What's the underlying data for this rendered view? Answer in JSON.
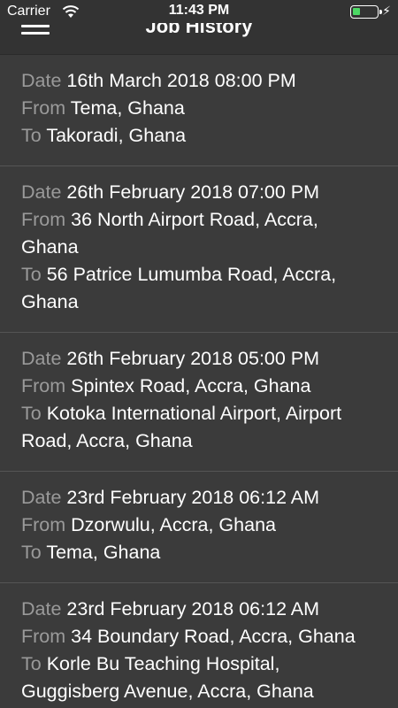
{
  "status_bar": {
    "carrier": "Carrier",
    "time": "11:43 PM",
    "battery_level": 0.3,
    "icons": [
      "wifi-icon",
      "battery-icon",
      "charging-bolt-icon"
    ]
  },
  "nav": {
    "title": "Job History",
    "menu_icon": "hamburger-menu-icon"
  },
  "labels": {
    "date": "Date",
    "from": "From",
    "to": "To"
  },
  "jobs": [
    {
      "date": "16th March 2018 08:00 PM",
      "from": "Tema, Ghana",
      "to": "Takoradi, Ghana"
    },
    {
      "date": "26th February 2018 07:00 PM",
      "from": "36 North Airport Road, Accra, Ghana",
      "to": "56 Patrice Lumumba Road, Accra, Ghana"
    },
    {
      "date": "26th February 2018 05:00 PM",
      "from": "Spintex Road, Accra, Ghana",
      "to": "Kotoka International Airport, Airport Road, Accra, Ghana"
    },
    {
      "date": "23rd February 2018 06:12 AM",
      "from": "Dzorwulu, Accra, Ghana",
      "to": "Tema, Ghana"
    },
    {
      "date": "23rd February 2018 06:12 AM",
      "from": "34 Boundary Road, Accra, Ghana",
      "to": "Korle Bu Teaching Hospital, Guggisberg Avenue, Accra, Ghana"
    }
  ],
  "colors": {
    "background": "#3b3b3b",
    "nav_background": "#333333",
    "label": "#9a9a9a",
    "value": "#ffffff",
    "battery": "#4cd964"
  }
}
